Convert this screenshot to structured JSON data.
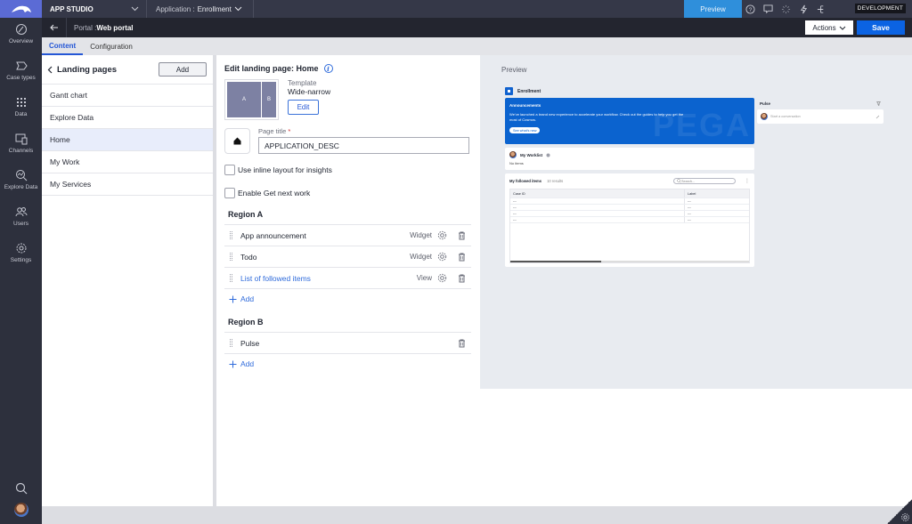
{
  "topbar": {
    "app_name": "APP STUDIO",
    "application_label": "Application :",
    "application_value": "Enrollment",
    "preview_label": "Preview",
    "environment_badge": "DEVELOPMENT"
  },
  "subbar": {
    "portal_label": "Portal :",
    "portal_name": "Web portal",
    "actions_label": "Actions",
    "save_label": "Save"
  },
  "rail": {
    "items": [
      {
        "label": "Overview",
        "icon": "overview-icon"
      },
      {
        "label": "Case types",
        "icon": "case-types-icon"
      },
      {
        "label": "Data",
        "icon": "data-grid-icon"
      },
      {
        "label": "Channels",
        "icon": "channels-icon"
      },
      {
        "label": "Explore Data",
        "icon": "explore-data-icon"
      },
      {
        "label": "Users",
        "icon": "users-icon"
      },
      {
        "label": "Settings",
        "icon": "settings-icon"
      }
    ]
  },
  "tabs": [
    {
      "label": "Content",
      "active": true
    },
    {
      "label": "Configuration",
      "active": false
    }
  ],
  "landing_pages": {
    "title": "Landing pages",
    "add_label": "Add",
    "items": [
      {
        "label": "Gantt chart",
        "selected": false
      },
      {
        "label": "Explore Data",
        "selected": false
      },
      {
        "label": "Home",
        "selected": true
      },
      {
        "label": "My Work",
        "selected": false
      },
      {
        "label": "My Services",
        "selected": false
      }
    ]
  },
  "editor": {
    "title": "Edit landing page: Home",
    "template_label": "Template",
    "template_value": "Wide-narrow",
    "template_region_a": "A",
    "template_region_b": "B",
    "edit_label": "Edit",
    "page_title_label": "Page title",
    "required_mark": "*",
    "page_title_value": "APPLICATION_DESC",
    "inline_layout_label": "Use inline layout for insights",
    "inline_layout_checked": false,
    "get_next_work_label": "Enable Get next work",
    "get_next_work_checked": false,
    "regions": [
      {
        "title": "Region A",
        "items": [
          {
            "label": "App announcement",
            "type": "Widget",
            "link": false,
            "has_settings": true
          },
          {
            "label": "Todo",
            "type": "Widget",
            "link": false,
            "has_settings": true
          },
          {
            "label": "List of followed items",
            "type": "View",
            "link": true,
            "has_settings": true
          }
        ],
        "add_label": "Add"
      },
      {
        "title": "Region B",
        "items": [
          {
            "label": "Pulse",
            "type": "",
            "link": false,
            "has_settings": false
          }
        ],
        "add_label": "Add"
      }
    ]
  },
  "preview": {
    "label": "Preview",
    "app_name": "Enrollment",
    "announcement": {
      "title": "Announcements",
      "text": "We've launched a brand new experience to accelerate your workflow. Check out the guides to help you get the most of Cosmos.",
      "button": "See what's new",
      "watermark": "PEGA"
    },
    "worklist": {
      "title": "My Worklist",
      "empty": "No items"
    },
    "followed": {
      "title": "My followed items",
      "count": "10 results",
      "search_placeholder": "Search...",
      "columns": [
        "Case ID",
        "Label"
      ],
      "rows": [
        [
          "---",
          "---"
        ],
        [
          "---",
          "---"
        ],
        [
          "---",
          "---"
        ],
        [
          "---",
          "---"
        ]
      ]
    },
    "pulse": {
      "title": "Pulse",
      "placeholder": "Start a conversation"
    }
  },
  "colors": {
    "accent": "#0b63e3",
    "link": "#2f6bdb",
    "rail": "#2d303d",
    "preview_btn": "#2f8fdb",
    "announcement": "#0b63cf"
  }
}
